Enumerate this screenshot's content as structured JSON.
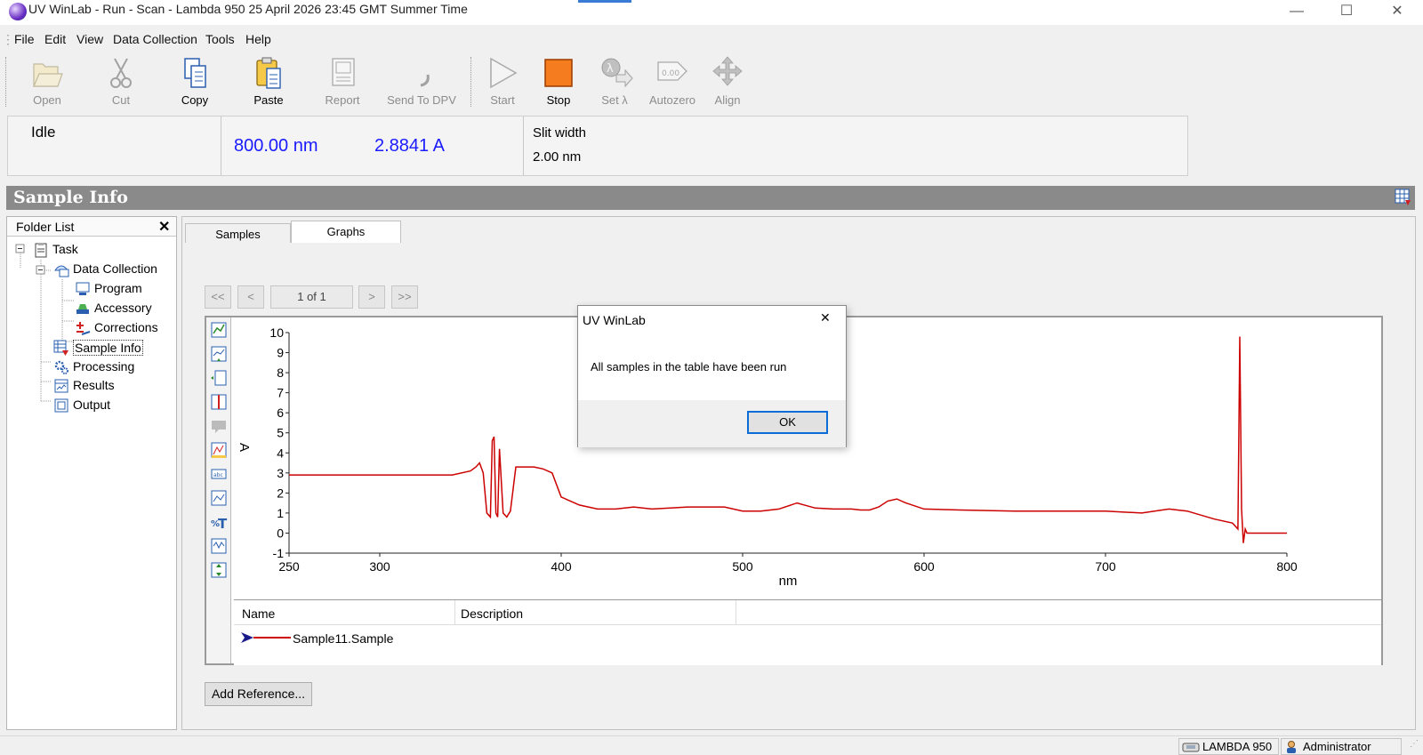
{
  "window": {
    "title": "UV WinLab - Run - Scan - Lambda 950 25 April 2026 23:45 GMT Summer Time",
    "minimize": "—",
    "maximize": "☐",
    "close": "✕"
  },
  "menu": [
    "File",
    "Edit",
    "View",
    "Data Collection",
    "Tools",
    "Help"
  ],
  "toolbar": {
    "open": "Open",
    "cut": "Cut",
    "copy": "Copy",
    "paste": "Paste",
    "report": "Report",
    "send_to_dpv": "Send To DPV",
    "start": "Start",
    "stop": "Stop",
    "set_lambda": "Set λ",
    "autozero": "Autozero",
    "autozero_icon_text": "0.00",
    "align": "Align"
  },
  "status_panel": {
    "state": "Idle",
    "wavelength": "800.00 nm",
    "absorbance": "2.8841 A",
    "slit_label": "Slit width",
    "slit_value": "2.00 nm"
  },
  "section_title": "Sample Info",
  "folder_list": {
    "header": "Folder List",
    "close": "✕",
    "items": [
      "Task",
      "Data Collection",
      "Program",
      "Accessory",
      "Corrections",
      "Sample Info",
      "Processing",
      "Results",
      "Output"
    ]
  },
  "tabs": {
    "samples": "Samples",
    "graphs": "Graphs"
  },
  "pager": {
    "first": "<<",
    "prev": "<",
    "page": "1 of 1",
    "next": ">",
    "last": ">>"
  },
  "legend": {
    "col_name": "Name",
    "col_description": "Description",
    "sample_name": "Sample11.Sample"
  },
  "add_reference": "Add Reference...",
  "dialog": {
    "title": "UV WinLab",
    "close": "✕",
    "message": "All samples in the table have been run",
    "ok": "OK"
  },
  "statusbar": {
    "instrument": "LAMBDA 950",
    "user": "Administrator"
  },
  "colors": {
    "trace": "#cc0000",
    "value_blue": "#1a1aff",
    "header_gray": "#8a8a8a",
    "stop_orange": "#f57c1f"
  },
  "chart_data": {
    "type": "line",
    "xlabel": "nm",
    "ylabel": "A",
    "xlim": [
      250,
      800
    ],
    "ylim": [
      -1,
      10
    ],
    "x_ticks": [
      250,
      300,
      400,
      500,
      600,
      700,
      800
    ],
    "y_ticks": [
      -1,
      0,
      1,
      2,
      3,
      4,
      5,
      6,
      7,
      8,
      9,
      10
    ],
    "series": [
      {
        "color": "#cc0000",
        "x": [
          250,
          300,
          340,
          350,
          353,
          355,
          357,
          359,
          361,
          362,
          363,
          364,
          365,
          366,
          368,
          370,
          372,
          375,
          385,
          390,
          395,
          400,
          405,
          410,
          420,
          430,
          440,
          450,
          460,
          470,
          480,
          490,
          500,
          510,
          520,
          530,
          540,
          550,
          560,
          565,
          570,
          575,
          580,
          585,
          590,
          600,
          620,
          650,
          700,
          720,
          735,
          745,
          760,
          770,
          773,
          774,
          775,
          776,
          777,
          778,
          780,
          790,
          800
        ],
        "y": [
          2.9,
          2.9,
          2.9,
          3.1,
          3.3,
          3.5,
          3.0,
          1.0,
          0.8,
          4.6,
          4.8,
          1.0,
          0.8,
          4.2,
          1.0,
          0.8,
          1.1,
          3.3,
          3.3,
          3.2,
          3.0,
          1.8,
          1.6,
          1.4,
          1.2,
          1.2,
          1.3,
          1.2,
          1.25,
          1.3,
          1.3,
          1.3,
          1.1,
          1.1,
          1.2,
          1.5,
          1.25,
          1.2,
          1.2,
          1.15,
          1.15,
          1.3,
          1.6,
          1.7,
          1.5,
          1.2,
          1.15,
          1.1,
          1.1,
          1.0,
          1.2,
          1.1,
          0.7,
          0.5,
          0.2,
          9.8,
          1.2,
          -0.5,
          0.2,
          0.0,
          0.0,
          0.0,
          0.0
        ]
      }
    ]
  }
}
